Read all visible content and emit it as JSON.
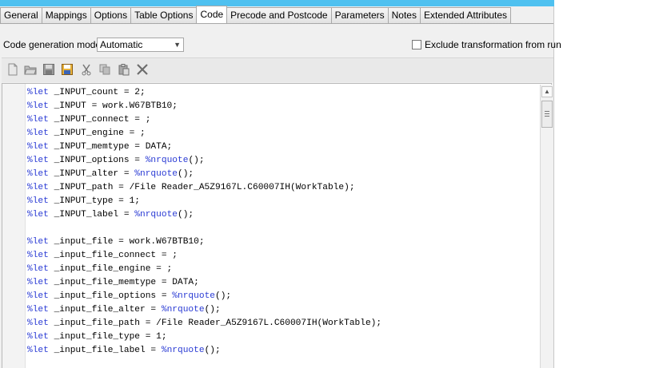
{
  "tabs": [
    {
      "label": "General"
    },
    {
      "label": "Mappings"
    },
    {
      "label": "Options"
    },
    {
      "label": "Table Options"
    },
    {
      "label": "Code",
      "active": true
    },
    {
      "label": "Precode and Postcode"
    },
    {
      "label": "Parameters"
    },
    {
      "label": "Notes"
    },
    {
      "label": "Extended Attributes"
    }
  ],
  "settings": {
    "mode_label": "Code generation mode:",
    "mode_value": "Automatic",
    "exclude_label": "Exclude transformation from run",
    "exclude_checked": false
  },
  "toolbar": {
    "icons": [
      "new-file-icon",
      "open-folder-icon",
      "save-icon",
      "save-as-icon",
      "cut-icon",
      "copy-icon",
      "paste-icon",
      "delete-icon"
    ]
  },
  "colors": {
    "keyword": "#2a3bd4",
    "title_bar": "#4fc1f0"
  },
  "code": {
    "lines": [
      {
        "kw": "%let",
        "rest": " _INPUT_count = 2;"
      },
      {
        "kw": "%let",
        "rest": " _INPUT = work.W67BTB10;"
      },
      {
        "kw": "%let",
        "rest": " _INPUT_connect = ;"
      },
      {
        "kw": "%let",
        "rest": " _INPUT_engine = ;"
      },
      {
        "kw": "%let",
        "rest": " _INPUT_memtype = DATA;"
      },
      {
        "kw": "%let",
        "rest": " _INPUT_options = ",
        "fn": "%nrquote",
        "tail": "();"
      },
      {
        "kw": "%let",
        "rest": " _INPUT_alter = ",
        "fn": "%nrquote",
        "tail": "();"
      },
      {
        "kw": "%let",
        "rest": " _INPUT_path = /File Reader_A5Z9167L.C60007IH(WorkTable);"
      },
      {
        "kw": "%let",
        "rest": " _INPUT_type = 1;"
      },
      {
        "kw": "%let",
        "rest": " _INPUT_label = ",
        "fn": "%nrquote",
        "tail": "();"
      },
      {
        "kw": "",
        "rest": ""
      },
      {
        "kw": "%let",
        "rest": " _input_file = work.W67BTB10;"
      },
      {
        "kw": "%let",
        "rest": " _input_file_connect = ;"
      },
      {
        "kw": "%let",
        "rest": " _input_file_engine = ;"
      },
      {
        "kw": "%let",
        "rest": " _input_file_memtype = DATA;"
      },
      {
        "kw": "%let",
        "rest": " _input_file_options = ",
        "fn": "%nrquote",
        "tail": "();"
      },
      {
        "kw": "%let",
        "rest": " _input_file_alter = ",
        "fn": "%nrquote",
        "tail": "();"
      },
      {
        "kw": "%let",
        "rest": " _input_file_path = /File Reader_A5Z9167L.C60007IH(WorkTable);"
      },
      {
        "kw": "%let",
        "rest": " _input_file_type = 1;"
      },
      {
        "kw": "%let",
        "rest": " _input_file_label = ",
        "fn": "%nrquote",
        "tail": "();"
      }
    ]
  }
}
